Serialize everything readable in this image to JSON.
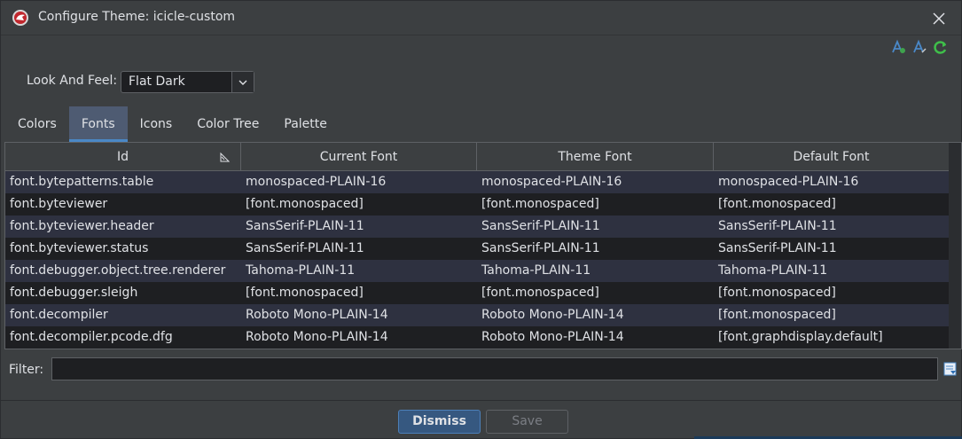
{
  "window": {
    "title": "Configure Theme: icicle-custom"
  },
  "toolbar": {
    "icons": [
      "add-font-icon",
      "edit-font-icon",
      "refresh-icon"
    ]
  },
  "look_and_feel": {
    "label": "Look And Feel:",
    "selected": "Flat Dark"
  },
  "tabs": [
    {
      "label": "Colors",
      "active": false
    },
    {
      "label": "Fonts",
      "active": true
    },
    {
      "label": "Icons",
      "active": false
    },
    {
      "label": "Color Tree",
      "active": false
    },
    {
      "label": "Palette",
      "active": false
    }
  ],
  "table": {
    "columns": [
      "Id",
      "Current Font",
      "Theme Font",
      "Default Font"
    ],
    "rows": [
      [
        "font.bytepatterns.table",
        "monospaced-PLAIN-16",
        "monospaced-PLAIN-16",
        "monospaced-PLAIN-16"
      ],
      [
        "font.byteviewer",
        "[font.monospaced]",
        "[font.monospaced]",
        "[font.monospaced]"
      ],
      [
        "font.byteviewer.header",
        "SansSerif-PLAIN-11",
        "SansSerif-PLAIN-11",
        "SansSerif-PLAIN-11"
      ],
      [
        "font.byteviewer.status",
        "SansSerif-PLAIN-11",
        "SansSerif-PLAIN-11",
        "SansSerif-PLAIN-11"
      ],
      [
        "font.debugger.object.tree.renderer",
        "Tahoma-PLAIN-11",
        "Tahoma-PLAIN-11",
        "Tahoma-PLAIN-11"
      ],
      [
        "font.debugger.sleigh",
        "[font.monospaced]",
        "[font.monospaced]",
        "[font.monospaced]"
      ],
      [
        "font.decompiler",
        "Roboto Mono-PLAIN-14",
        "Roboto Mono-PLAIN-14",
        "[font.monospaced]"
      ],
      [
        "font.decompiler.pcode.dfg",
        "Roboto Mono-PLAIN-14",
        "Roboto Mono-PLAIN-14",
        "[font.graphdisplay.default]"
      ]
    ]
  },
  "filter": {
    "label": "Filter:",
    "value": ""
  },
  "buttons": {
    "dismiss": "Dismiss",
    "save": "Save"
  },
  "colors": {
    "background": "#3c3f41",
    "table_bg": "#1e1f22",
    "row_alt": "#2e3140",
    "active_tab": "#4e5b72",
    "accent": "#4a88c7"
  }
}
